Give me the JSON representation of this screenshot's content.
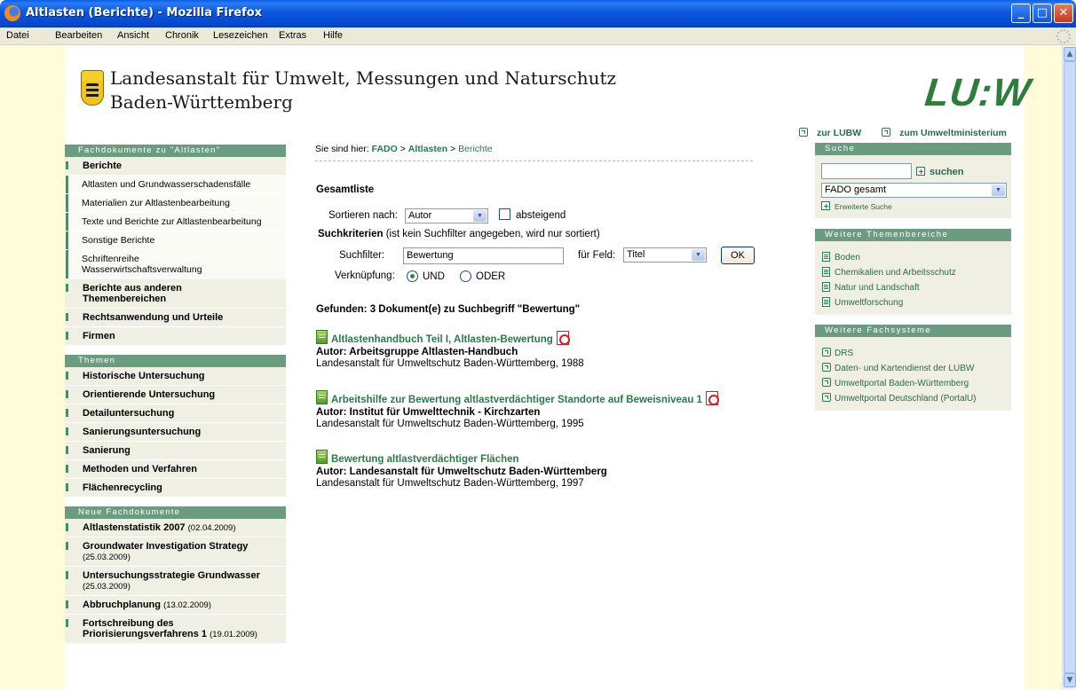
{
  "window": {
    "title": "Altlasten (Berichte) - Mozilla Firefox"
  },
  "menu": [
    "Datei",
    "Bearbeiten",
    "Ansicht",
    "Chronik",
    "Lesezeichen",
    "Extras",
    "Hilfe"
  ],
  "header": {
    "org_line1": "Landesanstalt für Umwelt, Messungen und Naturschutz",
    "org_line2": "Baden-Württemberg",
    "logo_text": "LU:W"
  },
  "leftnav": {
    "section1_title": "Fachdokumente zu \"Altlasten\"",
    "section1_items": [
      {
        "label": "Berichte",
        "bold": true
      },
      {
        "label": "Altlasten und Grundwasserschadensfälle",
        "sub": true
      },
      {
        "label": "Materialien zur Altlastenbearbeitung",
        "sub": true
      },
      {
        "label": "Texte und Berichte zur Altlastenbearbeitung",
        "sub": true
      },
      {
        "label": "Sonstige Berichte",
        "sub": true
      },
      {
        "label": "Schriftenreihe Wasserwirtschaftsverwaltung",
        "sub": true
      },
      {
        "label": "Berichte aus anderen Themenbereichen",
        "bold": true
      },
      {
        "label": "Rechtsanwendung und Urteile",
        "bold": true
      },
      {
        "label": "Firmen",
        "bold": true
      }
    ],
    "section2_title": "Themen",
    "section2_items": [
      "Historische Untersuchung",
      "Orientierende Untersuchung",
      "Detailuntersuchung",
      "Sanierungsuntersuchung",
      "Sanierung",
      "Methoden und Verfahren",
      "Flächenrecycling"
    ],
    "section3_title": "Neue Fachdokumente",
    "section3_items": [
      {
        "label": "Altlastenstatistik 2007",
        "date": "(02.04.2009)"
      },
      {
        "label": "Groundwater Investigation Strategy",
        "date": "(25.03.2009)"
      },
      {
        "label": "Untersuchungsstrategie Grundwasser",
        "date": "(25.03.2009)"
      },
      {
        "label": "Abbruchplanung",
        "date": "(13.02.2009)"
      },
      {
        "label": "Fortschreibung des Priorisierungsverfahrens 1",
        "date": "(19.01.2009)"
      }
    ]
  },
  "breadcrumb": {
    "prefix": "Sie sind hier:",
    "item1": "FADO",
    "sep": ">",
    "item2": "Altlasten",
    "current": "Berichte"
  },
  "main": {
    "heading": "Gesamtliste",
    "sort_label": "Sortieren nach:",
    "sort_value": "Autor",
    "desc_label": "absteigend",
    "criteria_bold": "Suchkriterien",
    "criteria_note": "(ist kein Suchfilter angegeben, wird nur sortiert)",
    "filter_label": "Suchfilter:",
    "filter_value": "Bewertung",
    "field_label": "für Feld:",
    "field_value": "Titel",
    "ok_label": "OK",
    "link_label": "Verknüpfung:",
    "und_label": "UND",
    "oder_label": "ODER",
    "found_text": "Gefunden: 3 Dokument(e) zu Suchbegriff \"Bewertung\""
  },
  "results": [
    {
      "title": "Altlastenhandbuch Teil I, Altlasten-Bewertung",
      "author": "Autor: Arbeitsgruppe Altlasten-Handbuch",
      "pub": "Landesanstalt für Umweltschutz Baden-Württemberg, 1988",
      "pdf": true
    },
    {
      "title": "Arbeitshilfe zur Bewertung altlastverdächtiger Standorte auf Beweisniveau 1",
      "author": "Autor: Institut für Umwelttechnik - Kirchzarten",
      "pub": "Landesanstalt für Umweltschutz Baden-Württemberg, 1995",
      "pdf": true
    },
    {
      "title": "Bewertung altlastverdächtiger Flächen",
      "author": "Autor: Landesanstalt für Umweltschutz Baden-Württemberg",
      "pub": "Landesanstalt für Umweltschutz Baden-Württemberg, 1997",
      "pdf": false
    }
  ],
  "right": {
    "link_lubw": "zur LUBW",
    "link_um": "zum Umweltministerium",
    "search_title": "Suche",
    "search_button": "suchen",
    "search_scope": "FADO gesamt",
    "advanced": "Erweiterte Suche",
    "themen_title": "Weitere Themenbereiche",
    "themen": [
      "Boden",
      "Chemikalien und Arbeitsschutz",
      "Natur und Landschaft",
      "Umweltforschung"
    ],
    "systeme_title": "Weitere Fachsysteme",
    "systeme": [
      "DRS",
      "Daten- und Kartendienst der LUBW",
      "Umweltportal Baden-Württemberg",
      "Umweltportal Deutschland (PortalU)"
    ]
  }
}
